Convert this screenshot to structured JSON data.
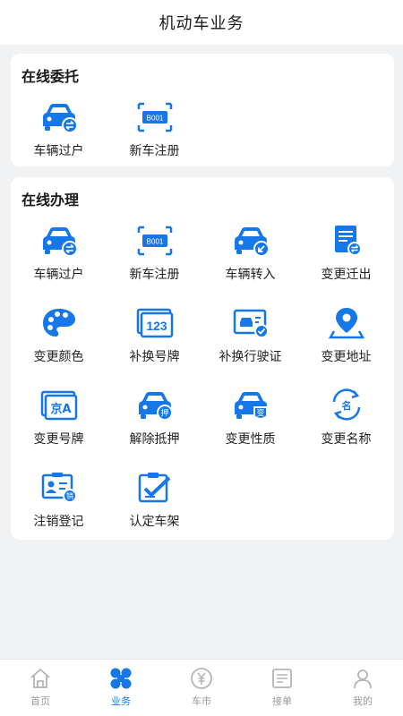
{
  "header": {
    "title": "机动车业务"
  },
  "online_entrust": {
    "title": "在线委托",
    "items": [
      {
        "label": "车辆过户",
        "icon": "car-transfer-icon"
      },
      {
        "label": "新车注册",
        "icon": "plate-register-icon"
      }
    ]
  },
  "online_handle": {
    "title": "在线办理",
    "items": [
      {
        "label": "车辆过户",
        "icon": "car-transfer-icon"
      },
      {
        "label": "新车注册",
        "icon": "plate-register-icon"
      },
      {
        "label": "车辆转入",
        "icon": "car-transfer-in-icon"
      },
      {
        "label": "变更迁出",
        "icon": "document-transfer-icon"
      },
      {
        "label": "变更颜色",
        "icon": "palette-icon"
      },
      {
        "label": "补换号牌",
        "icon": "plate-number-icon"
      },
      {
        "label": "补换行驶证",
        "icon": "license-card-icon"
      },
      {
        "label": "变更地址",
        "icon": "location-pin-icon"
      },
      {
        "label": "变更号牌",
        "icon": "plate-change-icon"
      },
      {
        "label": "解除抵押",
        "icon": "car-mortgage-icon"
      },
      {
        "label": "变更性质",
        "icon": "car-nature-change-icon"
      },
      {
        "label": "变更名称",
        "icon": "name-change-icon"
      },
      {
        "label": "注销登记",
        "icon": "cancel-registration-icon"
      },
      {
        "label": "认定车架",
        "icon": "clipboard-check-icon"
      }
    ],
    "plate_text_b001": "B001",
    "plate_text_123": "123",
    "plate_text_jinga": "京A",
    "badge_ya": "押",
    "badge_bian": "变",
    "badge_ming": "名",
    "badge_xiao": "销"
  },
  "tabbar": {
    "items": [
      {
        "label": "首页",
        "icon": "home-icon",
        "active": false
      },
      {
        "label": "业务",
        "icon": "business-grid-icon",
        "active": true
      },
      {
        "label": "车市",
        "icon": "yuan-coin-icon",
        "active": false
      },
      {
        "label": "接单",
        "icon": "order-list-icon",
        "active": false
      },
      {
        "label": "我的",
        "icon": "user-icon",
        "active": false
      }
    ]
  },
  "colors": {
    "accent": "#1677e8",
    "inactive": "#999999",
    "background": "#f1f2f4"
  }
}
